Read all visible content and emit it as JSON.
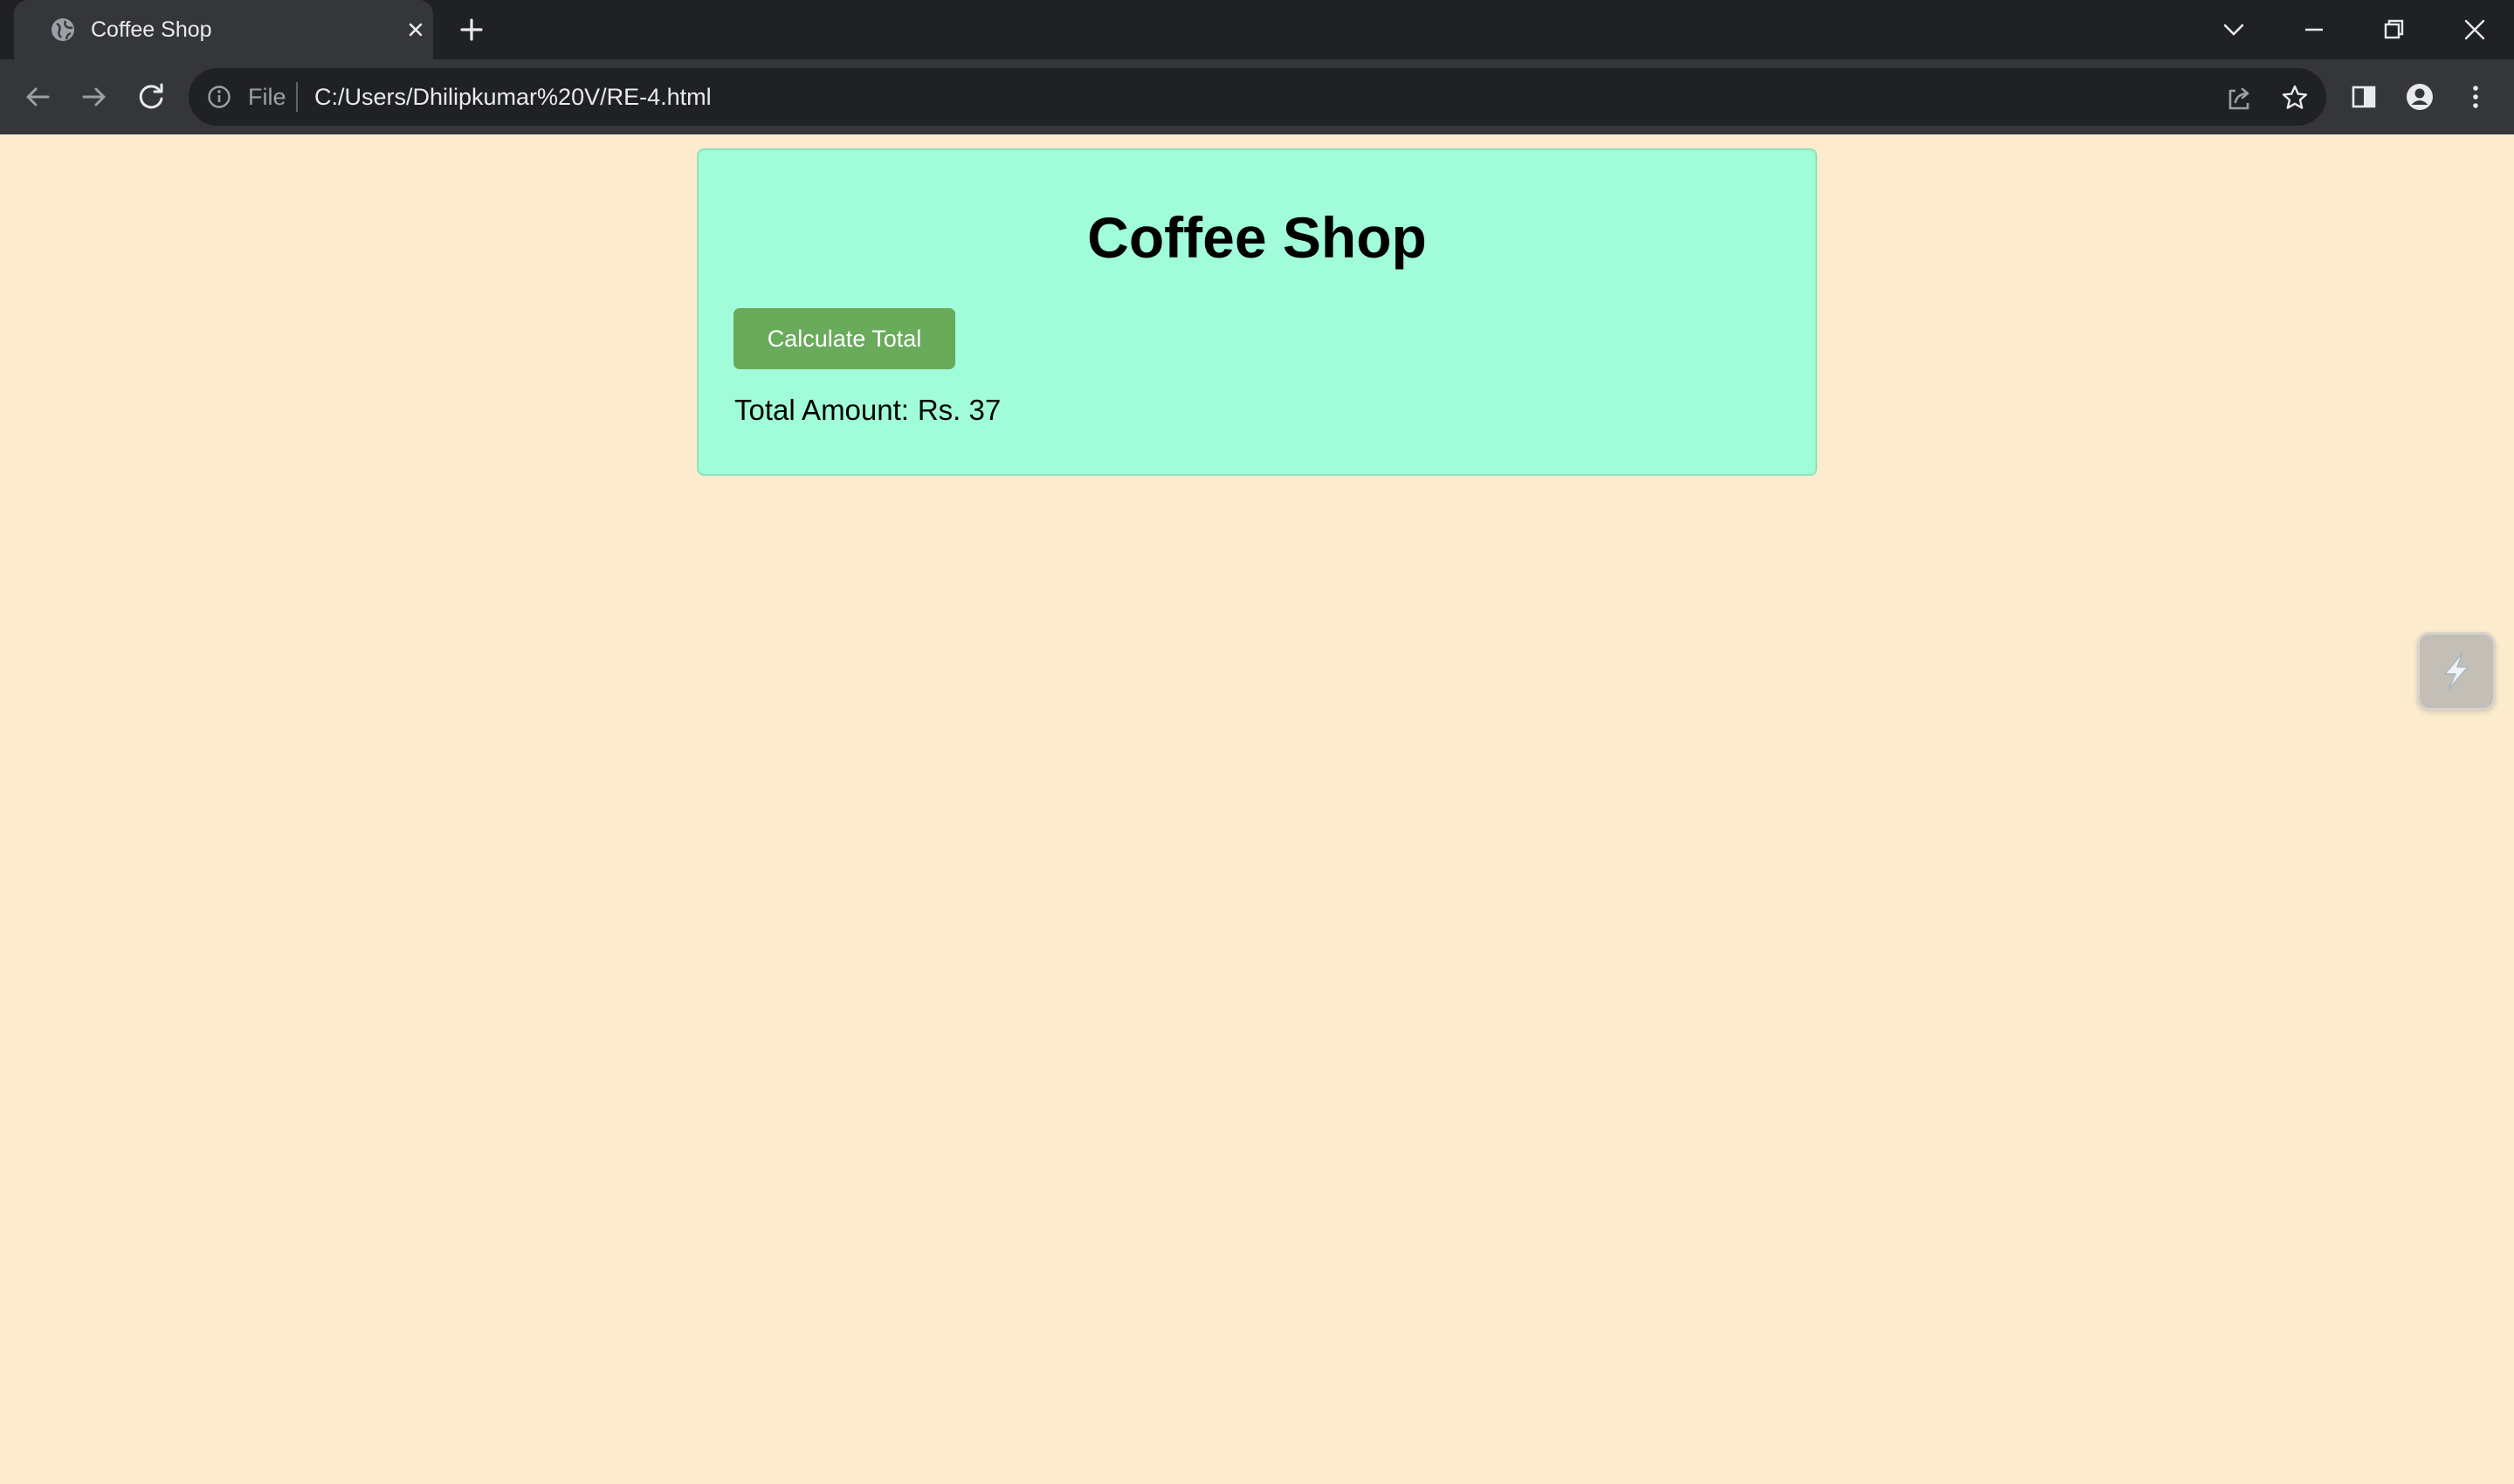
{
  "browser": {
    "tab_title": "Coffee Shop",
    "address_scheme": "File",
    "address_url": "C:/Users/Dhilipkumar%20V/RE-4.html"
  },
  "page": {
    "heading": "Coffee Shop",
    "calculate_button_label": "Calculate Total",
    "total_label": "Total Amount:",
    "total_value": "Rs. 37"
  },
  "colors": {
    "page_background": "#fcebcd",
    "card_background": "#a1fcd9",
    "button_background": "#69ab5b"
  },
  "icons": {
    "tab_favicon": "globe-icon",
    "tab_close": "close-icon",
    "new_tab": "plus-icon",
    "back": "arrow-left-icon",
    "forward": "arrow-right-icon",
    "reload": "reload-icon",
    "site_info": "info-icon",
    "share": "share-icon",
    "bookmark": "star-icon",
    "side_panel": "side-panel-icon",
    "profile": "profile-icon",
    "menu": "kebab-menu-icon",
    "extension_widget": "lightning-icon"
  }
}
